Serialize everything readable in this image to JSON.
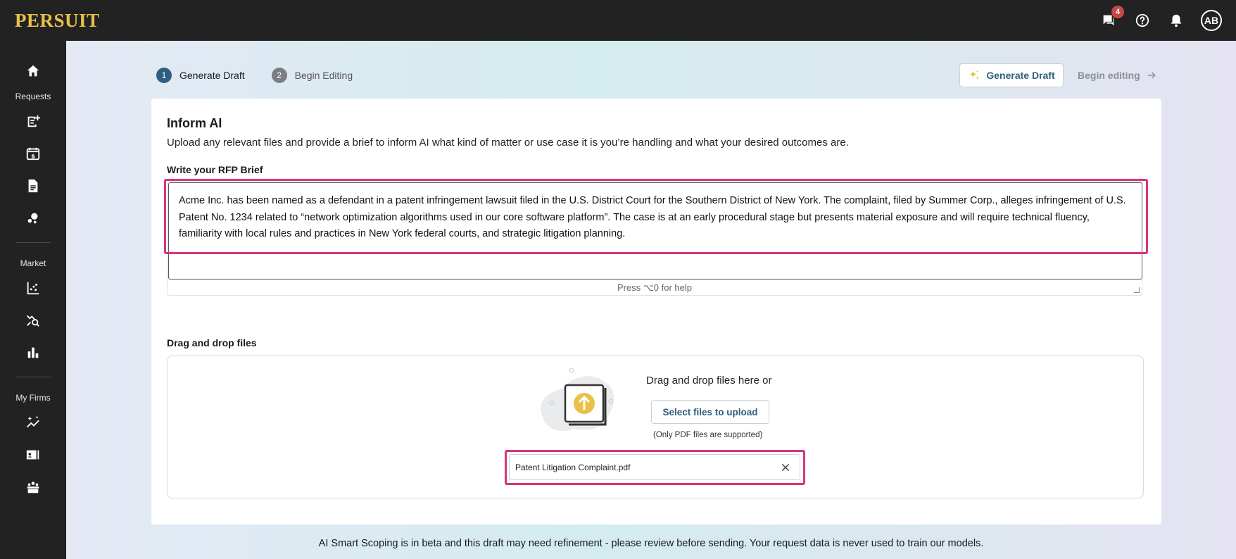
{
  "app": {
    "logo": "PERSUIT"
  },
  "topbar": {
    "messages_badge": "4",
    "avatar_initials": "AB"
  },
  "sidebar": {
    "sections": [
      {
        "label": ""
      },
      {
        "label": "Requests"
      },
      {
        "label": "Market"
      },
      {
        "label": "My Firms"
      }
    ]
  },
  "stepper": {
    "steps": [
      {
        "number": "1",
        "label": "Generate Draft"
      },
      {
        "number": "2",
        "label": "Begin Editing"
      }
    ]
  },
  "actions": {
    "generate_label": "Generate Draft",
    "begin_label": "Begin editing"
  },
  "inform": {
    "title": "Inform AI",
    "description": "Upload any relevant files and provide a brief to inform AI what kind of matter or use case it is you’re handling and what your desired outcomes are."
  },
  "brief": {
    "label": "Write your RFP Brief",
    "value": "Acme Inc. has been named as a defendant in a patent infringement lawsuit filed in the U.S. District Court for the Southern District of New York. The complaint, filed by Summer Corp., alleges infringement of U.S. Patent No. 1234 related to “network optimization algorithms used in our core software platform”. The case is at an early procedural stage but presents material exposure and will require technical fluency, familiarity with local rules and practices in New York federal courts, and strategic litigation planning.",
    "help": "Press ⌥0 for help"
  },
  "upload": {
    "label": "Drag and drop files",
    "drop_text": "Drag and drop files here or",
    "select_label": "Select files to upload",
    "note": "(Only PDF files are supported)",
    "files": [
      {
        "name": "Patent Litigation Complaint.pdf"
      }
    ]
  },
  "footer": {
    "note": "AI Smart Scoping is in beta and this draft may need refinement - please review before sending. Your request data is never used to train our models."
  },
  "colors": {
    "accent": "#2f5f7f",
    "logo": "#e8c14a",
    "highlight": "#d9357a",
    "sidebar": "#222222"
  }
}
